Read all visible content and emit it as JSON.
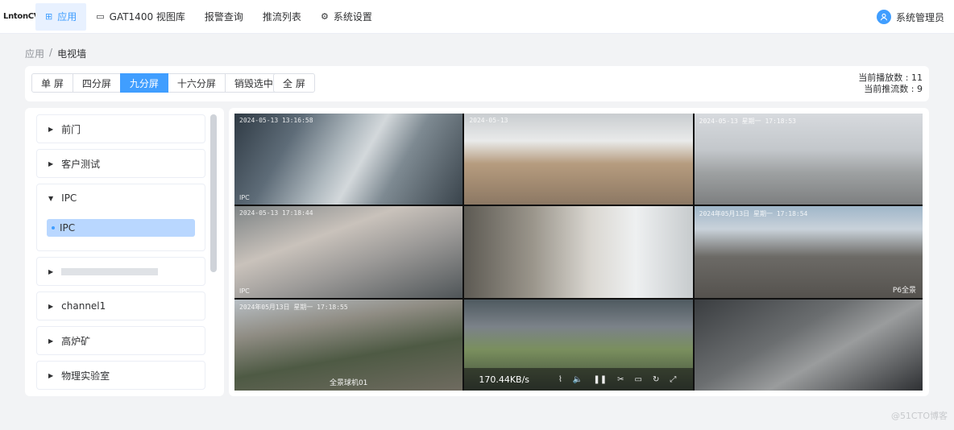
{
  "app": {
    "logo": "LntonCVS"
  },
  "nav": [
    {
      "icon": "⊞",
      "label": "应用",
      "active": true
    },
    {
      "icon": "▭",
      "label": "GAT1400 视图库"
    },
    {
      "icon": "",
      "label": "报警查询"
    },
    {
      "icon": "",
      "label": "推流列表"
    },
    {
      "icon": "⚙",
      "label": "系统设置"
    }
  ],
  "user": {
    "name": "系统管理员"
  },
  "breadcrumb": {
    "root": "应用",
    "sep": "/",
    "current": "电视墙"
  },
  "toolbar": {
    "layouts": [
      "单 屏",
      "四分屏",
      "九分屏",
      "十六分屏",
      "销毁选中"
    ],
    "active_layout": "九分屏",
    "fullscreen": "全 屏",
    "stats": {
      "playing": "当前播放数 : 11",
      "pushing": "当前推流数 : 9"
    }
  },
  "sidebar": {
    "groups": [
      {
        "label": "前门",
        "expanded": false
      },
      {
        "label": "客户测试",
        "expanded": false
      },
      {
        "label": "IPC",
        "expanded": true,
        "children": [
          "IPC"
        ]
      },
      {
        "label": "",
        "expanded": false,
        "redacted": true
      },
      {
        "label": "channel1",
        "expanded": false
      },
      {
        "label": "高炉矿",
        "expanded": false
      },
      {
        "label": "物理实验室",
        "expanded": false
      }
    ]
  },
  "wall": {
    "cells": [
      {
        "osd": "2024-05-13 13:16:58",
        "caption": "IPC"
      },
      {
        "osd": "2024-05-13",
        "caption": ""
      },
      {
        "osd": "2024-05-13  星期一  17:18:53",
        "caption": ""
      },
      {
        "osd": "2024-05-13 17:18:44",
        "caption": "IPC"
      },
      {
        "osd": "",
        "caption": ""
      },
      {
        "osd": "2024年05月13日 星期一 17:18:54",
        "caption_right": "P6全景"
      },
      {
        "osd": "2024年05月13日 星期一 17:18:55",
        "caption_center": "全景球机01"
      },
      {
        "osd": "",
        "caption": ""
      },
      {
        "osd": "",
        "caption": ""
      }
    ],
    "player": {
      "rate": "170.44KB/s"
    }
  },
  "watermark": "@51CTO博客"
}
